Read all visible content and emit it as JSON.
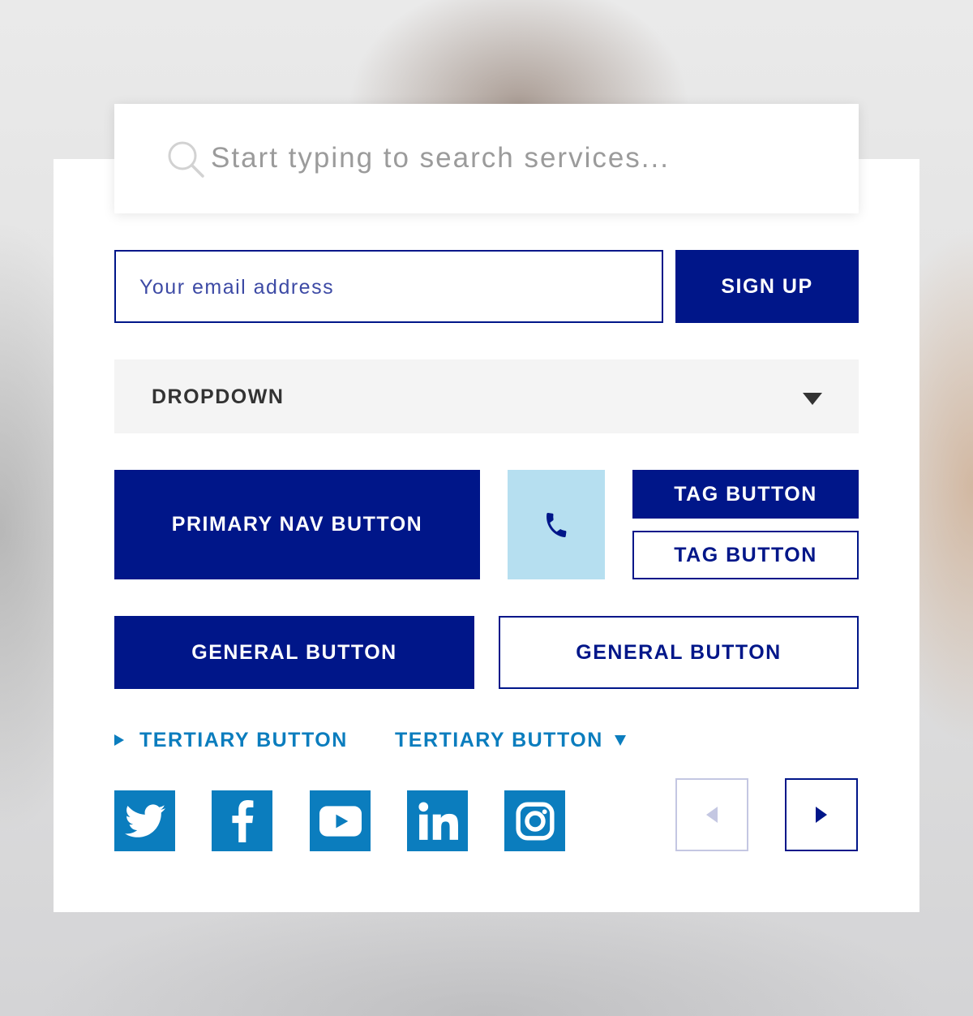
{
  "search": {
    "placeholder": "Start typing to search services...",
    "icon": "search-icon"
  },
  "signup_form": {
    "email_placeholder": "Your email address",
    "submit_label": "SIGN UP"
  },
  "dropdown": {
    "label": "DROPDOWN",
    "icon": "caret-down-icon"
  },
  "buttons": {
    "primary_nav": "PRIMARY NAV BUTTON",
    "phone_icon": "phone-icon",
    "tag_filled": "TAG BUTTON",
    "tag_outline": "TAG BUTTON",
    "general_filled": "GENERAL BUTTON",
    "general_outline": "GENERAL BUTTON",
    "tertiary_right": "TERTIARY BUTTON",
    "tertiary_down": "TERTIARY BUTTON"
  },
  "social": [
    {
      "name": "twitter",
      "icon": "twitter-icon"
    },
    {
      "name": "facebook",
      "icon": "facebook-icon"
    },
    {
      "name": "youtube",
      "icon": "youtube-icon"
    },
    {
      "name": "linkedin",
      "icon": "linkedin-icon"
    },
    {
      "name": "instagram",
      "icon": "instagram-icon"
    }
  ],
  "pager": {
    "prev_icon": "arrow-left-icon",
    "prev_state": "disabled",
    "next_icon": "arrow-right-icon",
    "next_state": "enabled"
  },
  "colors": {
    "navy": "#001689",
    "accent_blue": "#0b7dbe",
    "phone_bg": "#b6dff0",
    "dropdown_bg": "#f4f4f4",
    "disabled_border": "#c4c7e2"
  }
}
